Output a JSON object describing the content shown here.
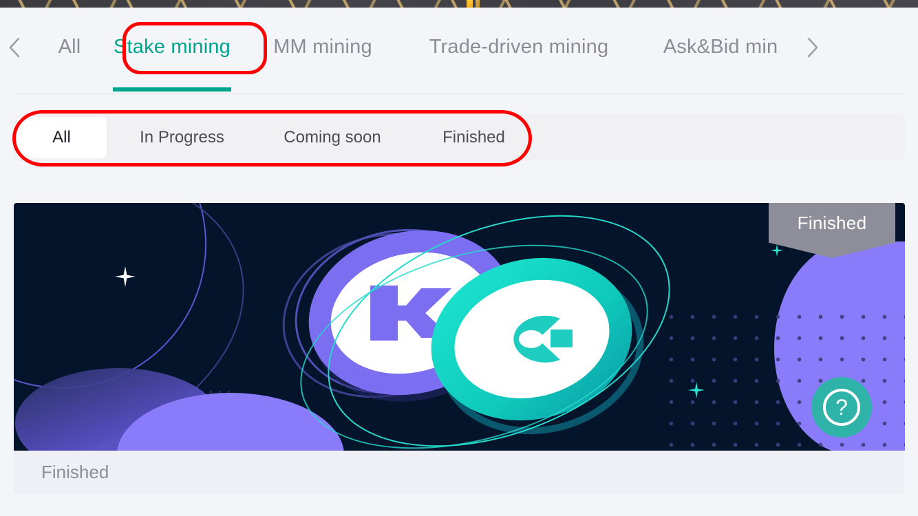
{
  "page": {
    "background_color": "#f4f5f8",
    "accent_color": "#00a48c"
  },
  "top_strip": {
    "name": "partially-visible-promo-banner",
    "colors": {
      "base": "#3f3f45",
      "stripe": "#d4b26e",
      "highlight": "#ffc83d"
    }
  },
  "tabbar": {
    "prev_arrow": "‹",
    "next_arrow": "›",
    "active_index": 1,
    "tabs": [
      {
        "label": "All"
      },
      {
        "label": "Stake mining"
      },
      {
        "label": "MM mining"
      },
      {
        "label": "Trade-driven mining"
      },
      {
        "label": "Ask&Bid min"
      }
    ]
  },
  "filters": {
    "selected_index": 0,
    "items": [
      {
        "label": "All"
      },
      {
        "label": "In Progress"
      },
      {
        "label": "Coming soon"
      },
      {
        "label": "Finished"
      }
    ]
  },
  "annotations": [
    {
      "target": "tab-stake-mining",
      "shape": "rounded-rect-oval",
      "color": "#ff0000"
    },
    {
      "target": "filter-pill-group",
      "shape": "oval",
      "color": "#ff0000"
    }
  ],
  "promo_card": {
    "banner": {
      "background_color": "#03142b",
      "purple": "#8a7bfb",
      "teal": "#1ee6d2",
      "coin_left_icon": "kucoin-k-logo",
      "coin_right_icon": "g-token-logo"
    },
    "status_ribbon": {
      "label": "Finished",
      "color": "#8d8e99"
    },
    "help_button": {
      "icon": "question-mark-icon",
      "color": "#2fb3a8"
    },
    "footer": {
      "status_label": "Finished"
    }
  }
}
